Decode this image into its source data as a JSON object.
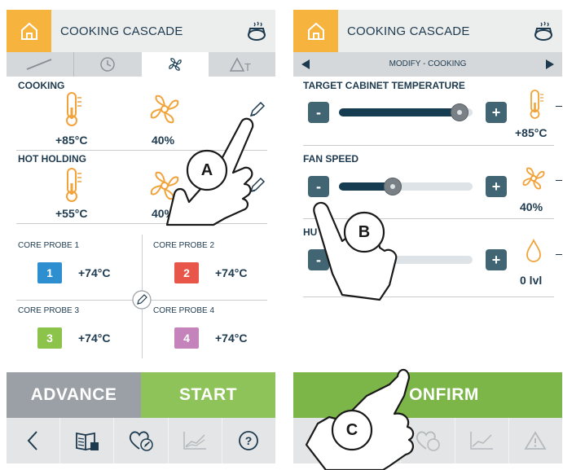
{
  "left": {
    "header": {
      "title": "COOKING CASCADE"
    },
    "cooking": {
      "title": "COOKING",
      "temp": "+85°C",
      "fan": "40%"
    },
    "holding": {
      "title": "HOT HOLDING",
      "temp": "+55°C",
      "fan": "40%"
    },
    "probes": [
      {
        "label": "CORE PROBE 1",
        "num": "1",
        "temp": "+74°C",
        "color": "#2e8fd0"
      },
      {
        "label": "CORE PROBE 2",
        "num": "2",
        "temp": "+74°C",
        "color": "#e8564a"
      },
      {
        "label": "CORE PROBE 3",
        "num": "3",
        "temp": "+74°C",
        "color": "#8cc34a"
      },
      {
        "label": "CORE PROBE 4",
        "num": "4",
        "temp": "+74°C",
        "color": "#c583bb"
      }
    ],
    "buttons": {
      "advance": "ADVANCE",
      "start": "START"
    }
  },
  "right": {
    "header": {
      "title": "COOKING CASCADE"
    },
    "modify": "MODIFY - COOKING",
    "rows": [
      {
        "title": "TARGET CABINET TEMPERATURE",
        "value": "+85°C",
        "level": 0.9
      },
      {
        "title": "FAN SPEED",
        "value": "40%",
        "level": 0.4
      },
      {
        "title": "HU",
        "value": "0 lvl",
        "level": 0.0
      }
    ],
    "confirm": "ONFIRM"
  },
  "callouts": {
    "a": "A",
    "b": "B",
    "c": "C"
  },
  "steppers": {
    "minus": "-",
    "plus": "+"
  },
  "colors": {
    "orange": "#f6b33d",
    "green": "#8dc358",
    "navy": "#1e3a4f",
    "grey": "#9aa0a5"
  }
}
